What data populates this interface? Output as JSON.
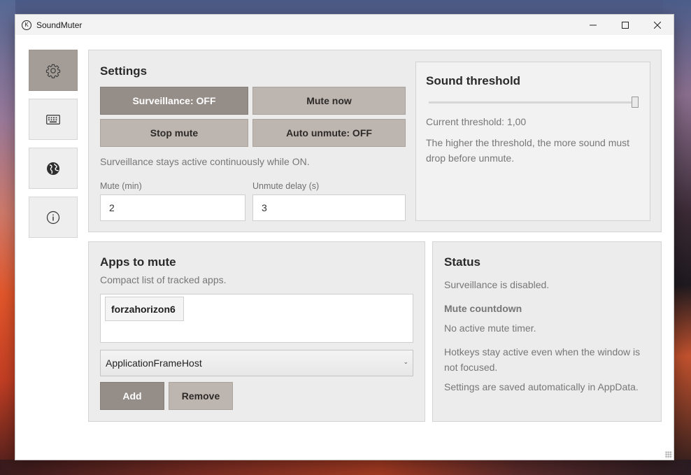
{
  "window": {
    "title": "SoundMuter",
    "app_icon": "K"
  },
  "sidebar": {
    "items": [
      {
        "name": "settings",
        "icon": "gear-icon",
        "active": true
      },
      {
        "name": "hotkeys",
        "icon": "keyboard-icon",
        "active": false
      },
      {
        "name": "language",
        "icon": "globe-icon",
        "active": false
      },
      {
        "name": "about",
        "icon": "info-icon",
        "active": false
      }
    ]
  },
  "settings": {
    "title": "Settings",
    "surveillance_btn": "Surveillance: OFF",
    "mute_now_btn": "Mute now",
    "stop_mute_btn": "Stop mute",
    "auto_unmute_btn": "Auto unmute: OFF",
    "hint": "Surveillance stays active continuously while ON.",
    "mute_label": "Mute (min)",
    "mute_value": "2",
    "unmute_delay_label": "Unmute delay (s)",
    "unmute_delay_value": "3"
  },
  "threshold": {
    "title": "Sound threshold",
    "current": "Current threshold: 1,00",
    "slider_fraction": 1.0,
    "description": "The higher the threshold, the more sound must drop before unmute."
  },
  "apps": {
    "title": "Apps to mute",
    "subtitle": "Compact list of tracked apps.",
    "tracked": [
      "forzahorizon6"
    ],
    "selected_process": "ApplicationFrameHost",
    "add_btn": "Add",
    "remove_btn": "Remove"
  },
  "status": {
    "title": "Status",
    "surveillance_text": "Surveillance is disabled.",
    "countdown_title": "Mute countdown",
    "countdown_text": "No active mute timer.",
    "hotkeys_note": "Hotkeys stay active even when the window is not focused.",
    "saved_note": "Settings are saved automatically in AppData."
  },
  "colors": {
    "accent_dark": "#958d88",
    "accent_light": "#bdb5b0",
    "panel_bg": "#ececec"
  }
}
